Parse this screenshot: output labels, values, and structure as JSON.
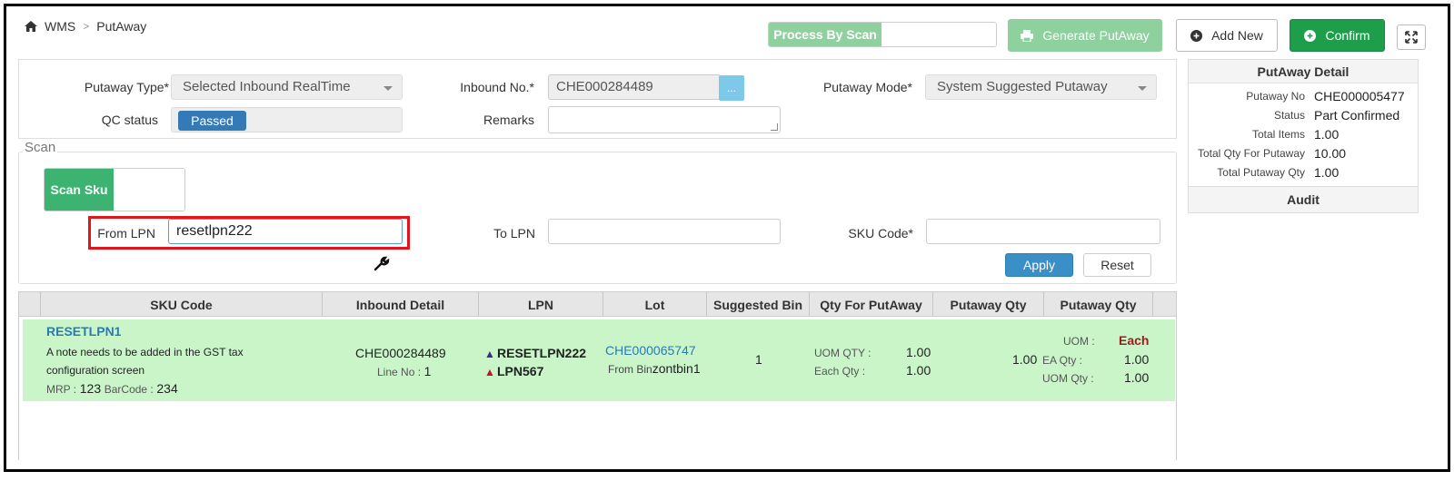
{
  "breadcrumb": {
    "root": "WMS",
    "separator": ">",
    "current": "PutAway"
  },
  "toolbar": {
    "process_by_scan": "Process By Scan",
    "generate_putaway": "Generate PutAway",
    "add_new": "Add New",
    "confirm": "Confirm"
  },
  "form": {
    "putaway_type_label": "Putaway Type*",
    "putaway_type_value": "Selected Inbound RealTime",
    "inbound_no_label": "Inbound No.*",
    "inbound_no_value": "CHE000284489",
    "inbound_lookup_label": "...",
    "putaway_mode_label": "Putaway Mode*",
    "putaway_mode_value": "System Suggested Putaway",
    "qc_status_label": "QC status",
    "qc_status_value": "Passed",
    "remarks_label": "Remarks",
    "remarks_value": ""
  },
  "detail": {
    "title": "PutAway Detail",
    "rows": [
      {
        "key": "Putaway No",
        "value": "CHE000005477"
      },
      {
        "key": "Status",
        "value": "Part Confirmed"
      },
      {
        "key": "Total Items",
        "value": "1.00"
      },
      {
        "key": "Total Qty For Putaway",
        "value": "10.00"
      },
      {
        "key": "Total Putaway Qty",
        "value": "1.00"
      }
    ],
    "audit": "Audit"
  },
  "scan": {
    "legend": "Scan",
    "toggle_label": "Scan Sku",
    "from_lpn_label": "From LPN",
    "from_lpn_value": "resetlpn222",
    "to_lpn_label": "To LPN",
    "to_lpn_value": "",
    "sku_code_label": "SKU Code*",
    "sku_code_value": "",
    "apply": "Apply",
    "reset": "Reset"
  },
  "table": {
    "headers": [
      "SKU Code",
      "Inbound Detail",
      "LPN",
      "Lot",
      "Suggested Bin",
      "Qty For PutAway",
      "Putaway Qty",
      "Putaway Qty"
    ],
    "rows": [
      {
        "sku_code": "RESETLPN1",
        "description_line1": "A note needs to be added in the GST tax",
        "description_line2": "configuration screen",
        "mrp_label": "MRP :",
        "mrp_value": "123",
        "barcode_label": "BarCode :",
        "barcode_value": "234",
        "inbound_no": "CHE000284489",
        "line_no_label": "Line No :",
        "line_no_value": "1",
        "lpn_1": "RESETLPN222",
        "lpn_2": "LPN567",
        "lot": "CHE000065747",
        "from_bin_label": "From Bin",
        "from_bin_value": "zontbin1",
        "suggested_bin": "1",
        "uom_qty_label": "UOM QTY :",
        "uom_qty_value": "1.00",
        "each_qty_label": "Each Qty :",
        "each_qty_value": "1.00",
        "putaway_qty": "1.00",
        "uom_label": "UOM :",
        "uom_value": "Each",
        "ea_qty_label": "EA Qty :",
        "ea_qty_value": "1.00",
        "uom_qty2_label": "UOM Qty :",
        "uom_qty2_value": "1.00"
      }
    ]
  },
  "colors": {
    "primary": "#337ab7",
    "success": "#1e9e4a",
    "row_bg": "#c9f5c8",
    "highlight": "#e0161c"
  }
}
